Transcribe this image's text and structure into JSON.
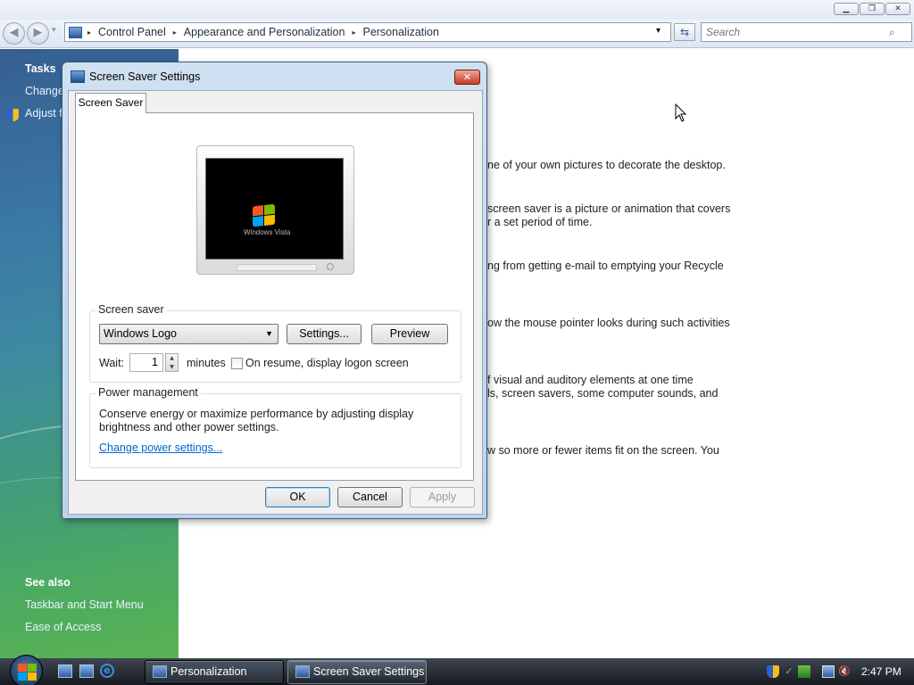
{
  "window": {
    "minimize_glyph": "▁",
    "restore_glyph": "❐",
    "close_glyph": "✕"
  },
  "navbar": {
    "back_glyph": "◀",
    "forward_glyph": "▶",
    "history_glyph": "▾",
    "breadcrumb": [
      "Control Panel",
      "Appearance and Personalization",
      "Personalization"
    ],
    "sep_glyph": "▸",
    "dropdown_glyph": "▾",
    "refresh_glyph": "⇆",
    "search_placeholder": "Search",
    "search_icon": "⌕"
  },
  "sidebar": {
    "tasks_heading": "Tasks",
    "tasks": [
      "Change",
      "Adjust f"
    ],
    "see_also_heading": "See also",
    "see_also": [
      "Taskbar and Start Menu",
      "Ease of Access"
    ]
  },
  "main": {
    "lines": [
      "ne of your own pictures to decorate the desktop.",
      "screen saver is a picture or animation that covers",
      "r a set period of time.",
      "ng from getting e-mail to emptying your Recycle",
      "ow the mouse pointer looks during such activities",
      "f visual and auditory elements at one time",
      "ls, screen savers, some computer sounds, and",
      "w so more or fewer items fit on the screen. You"
    ]
  },
  "dialog": {
    "title": "Screen Saver Settings",
    "close_glyph": "✕",
    "tab_label": "Screen Saver",
    "preview_logo_text": "Windows Vista",
    "screensaver_group_label": "Screen saver",
    "screensaver_selected": "Windows Logo",
    "select_arrow": "▼",
    "settings_label": "Settings...",
    "preview_label": "Preview",
    "wait_label": "Wait:",
    "wait_value": "1",
    "spin_up": "▲",
    "spin_down": "▼",
    "minutes_label": "minutes",
    "resume_label": "On resume, display logon screen",
    "resume_checked": false,
    "power_group_label": "Power management",
    "power_text_1": "Conserve energy or maximize performance by adjusting display",
    "power_text_2": "brightness and other power settings.",
    "power_link": "Change power settings...",
    "ok_label": "OK",
    "cancel_label": "Cancel",
    "apply_label": "Apply"
  },
  "taskbar": {
    "tasks": [
      "Personalization",
      "Screen Saver Settings"
    ],
    "clock": "2:47 PM"
  },
  "colors": {
    "sidebar_top": "#365f91",
    "sidebar_bottom": "#58b252",
    "link": "#0066cc",
    "logo_red": "#f15a24",
    "logo_green": "#7cbb00",
    "logo_blue": "#00a1f1",
    "logo_yellow": "#ffbb00"
  }
}
